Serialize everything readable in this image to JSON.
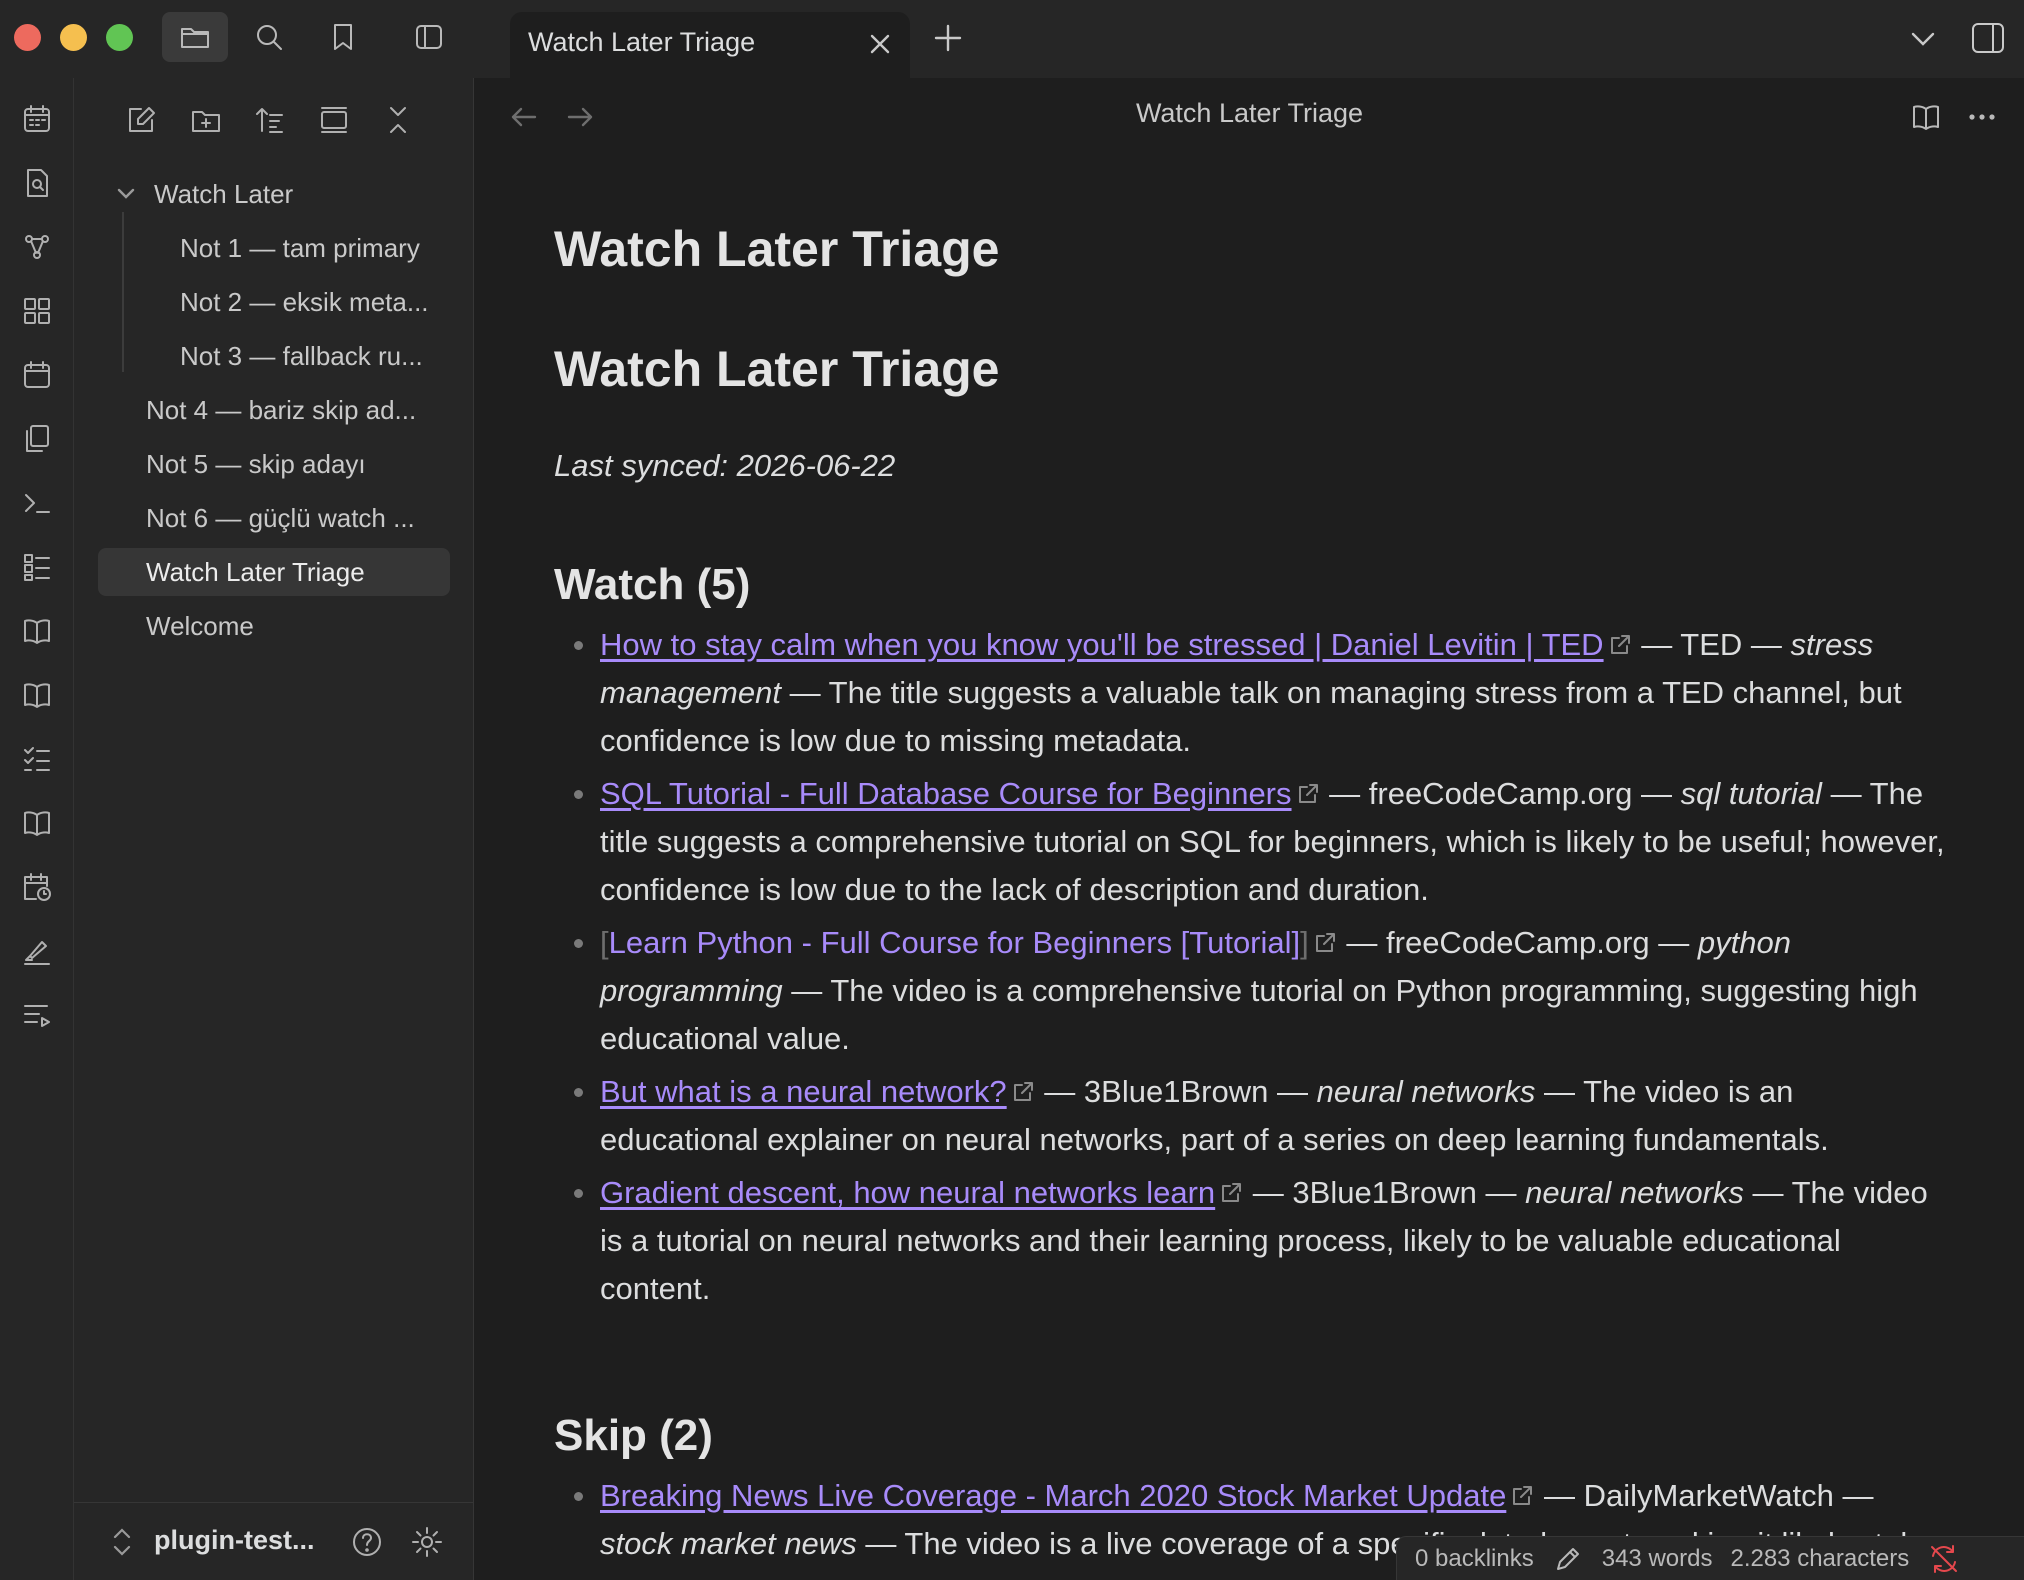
{
  "window": {
    "tab_title": "Watch Later Triage"
  },
  "sidebar": {
    "tree": [
      {
        "label": "Watch Later",
        "kind": "folder"
      },
      {
        "label": "Not 1 — tam primary",
        "kind": "child"
      },
      {
        "label": "Not 2 — eksik meta...",
        "kind": "child"
      },
      {
        "label": "Not 3 — fallback ru...",
        "kind": "child"
      },
      {
        "label": "Not 4 — bariz skip ad...",
        "kind": "top"
      },
      {
        "label": "Not 5 — skip adayı",
        "kind": "top"
      },
      {
        "label": "Not 6 — güçlü watch ...",
        "kind": "top"
      },
      {
        "label": "Watch Later Triage",
        "kind": "top",
        "active": true
      },
      {
        "label": "Welcome",
        "kind": "top"
      }
    ],
    "vault_name": "plugin-test..."
  },
  "main": {
    "view_title": "Watch Later Triage",
    "heading1": "Watch Later Triage",
    "heading2": "Watch Later Triage",
    "synced": "Last synced: 2026-06-22",
    "watch_heading": "Watch (5)",
    "watch": [
      {
        "link": "How to stay calm when you know you'll be stressed | Daniel Levitin | TED",
        "channel": "TED",
        "topic": "stress management",
        "desc": "The title suggests a valuable talk on managing stress from a TED channel, but confidence is low due to missing metadata."
      },
      {
        "link": "SQL Tutorial - Full Database Course for Beginners",
        "channel": "freeCodeCamp.org",
        "topic": "sql tutorial",
        "desc": "The title suggests a comprehensive tutorial on SQL for beginners, which is likely to be useful; however, confidence is low due to the lack of description and duration."
      },
      {
        "link": "Learn Python - Full Course for Beginners [Tutorial]",
        "channel": "freeCodeCamp.org",
        "topic": "python programming",
        "desc": "The video is a comprehensive tutorial on Python programming, suggesting high educational value."
      },
      {
        "link": "But what is a neural network?",
        "channel": "3Blue1Brown",
        "topic": "neural networks",
        "desc": "The video is an educational explainer on neural networks, part of a series on deep learning fundamentals."
      },
      {
        "link": "Gradient descent, how neural networks learn",
        "channel": "3Blue1Brown",
        "topic": "neural networks",
        "desc": "The video is a tutorial on neural networks and their learning process, likely to be valuable educational content."
      }
    ],
    "skip_heading": "Skip (2)",
    "skip": [
      {
        "link": "Breaking News Live Coverage - March 2020 Stock Market Update",
        "channel": "DailyMarketWatch",
        "topic": "stock market news",
        "desc": "The video is a live coverage of a specific dated event, making it likely stale."
      }
    ],
    "sep": "—",
    "bracket_open": "[",
    "bracket_close": "]"
  },
  "status": {
    "backlinks": "0 backlinks",
    "words": "343 words",
    "characters": "2.283 characters"
  },
  "colors": {
    "accent_link": "#a88bfa",
    "sync_error": "#e5484d"
  }
}
